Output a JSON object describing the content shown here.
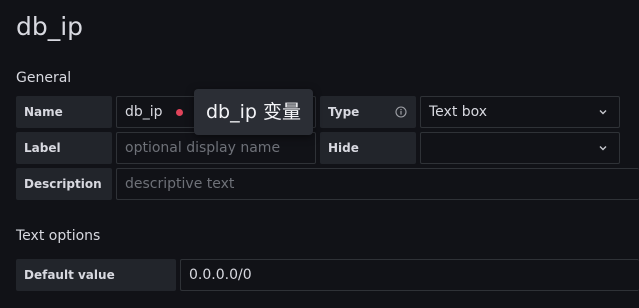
{
  "page": {
    "title": "db_ip"
  },
  "general": {
    "heading": "General",
    "name_label": "Name",
    "name_value": "db_ip",
    "name_tooltip": "db_ip 变量",
    "type_label": "Type",
    "type_value": "Text box",
    "label_label": "Label",
    "label_placeholder": "optional display name",
    "hide_label": "Hide",
    "hide_value": "",
    "description_label": "Description",
    "description_placeholder": "descriptive text"
  },
  "text_options": {
    "heading": "Text options",
    "default_value_label": "Default value",
    "default_value": "0.0.0.0/0"
  },
  "icons": {
    "error_dot": "error-dot-icon",
    "info": "info-icon",
    "chevron": "chevron-down-icon"
  },
  "colors": {
    "background": "#111217",
    "label_bg": "#22252b",
    "error": "#e0435a"
  }
}
